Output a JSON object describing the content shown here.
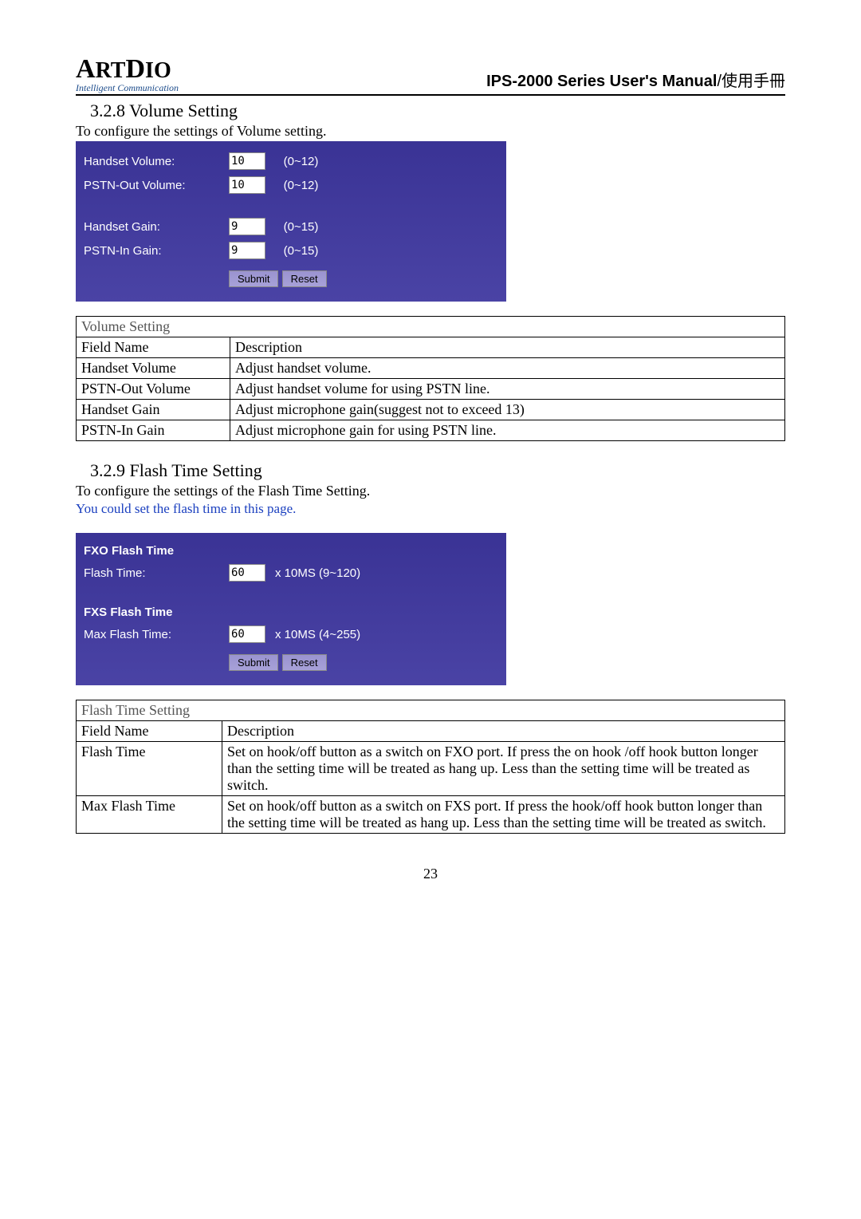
{
  "header": {
    "logo_main": "ARTDIO",
    "logo_sub": "Intelligent Communication",
    "title_en": "IPS-2000 Series User's Manual",
    "title_cn": "/使用手冊"
  },
  "section1": {
    "heading": "3.2.8 Volume Setting",
    "intro": "To configure the settings of Volume setting."
  },
  "volume_form": {
    "handset_volume_label": "Handset Volume:",
    "handset_volume_value": "10",
    "handset_volume_range": "(0~12)",
    "pstn_out_label": "PSTN-Out Volume:",
    "pstn_out_value": "10",
    "pstn_out_range": "(0~12)",
    "handset_gain_label": "Handset Gain:",
    "handset_gain_value": "9",
    "handset_gain_range": "(0~15)",
    "pstn_in_label": "PSTN-In Gain:",
    "pstn_in_value": "9",
    "pstn_in_range": "(0~15)",
    "submit": "Submit",
    "reset": "Reset"
  },
  "volume_table": {
    "title": "Volume Setting",
    "h1": "Field Name",
    "h2": "Description",
    "rows": [
      {
        "f": "Handset Volume",
        "d": "Adjust handset volume."
      },
      {
        "f": "PSTN-Out Volume",
        "d": "Adjust handset volume for using PSTN line."
      },
      {
        "f": "Handset Gain",
        "d": "Adjust microphone gain(suggest not to exceed 13)"
      },
      {
        "f": "PSTN-In Gain",
        "d": "Adjust microphone gain for using PSTN line."
      }
    ]
  },
  "section2": {
    "heading": "3.2.9 Flash Time Setting",
    "intro": "To configure the settings of the Flash Time Setting.",
    "note": "You could set the flash time in this page."
  },
  "flash_form": {
    "fxo_heading": "FXO Flash Time",
    "fxo_label": "Flash Time:",
    "fxo_value": "60",
    "fxo_range": "x 10MS (9~120)",
    "fxs_heading": "FXS Flash Time",
    "fxs_label": "Max Flash Time:",
    "fxs_value": "60",
    "fxs_range": "x 10MS (4~255)",
    "submit": "Submit",
    "reset": "Reset"
  },
  "flash_table": {
    "title": "Flash Time Setting",
    "h1": "Field Name",
    "h2": "Description",
    "rows": [
      {
        "f": "Flash Time",
        "d": "Set on hook/off button as a switch on FXO port. If press the on hook /off hook button longer than the setting time will be treated as hang up. Less than the setting time will be treated as switch."
      },
      {
        "f": "Max Flash Time",
        "d": "Set on hook/off button as a switch on FXS port. If press the hook/off hook button longer than the setting time will be treated as hang up. Less than the setting time will be treated as switch."
      }
    ]
  },
  "page_number": "23"
}
